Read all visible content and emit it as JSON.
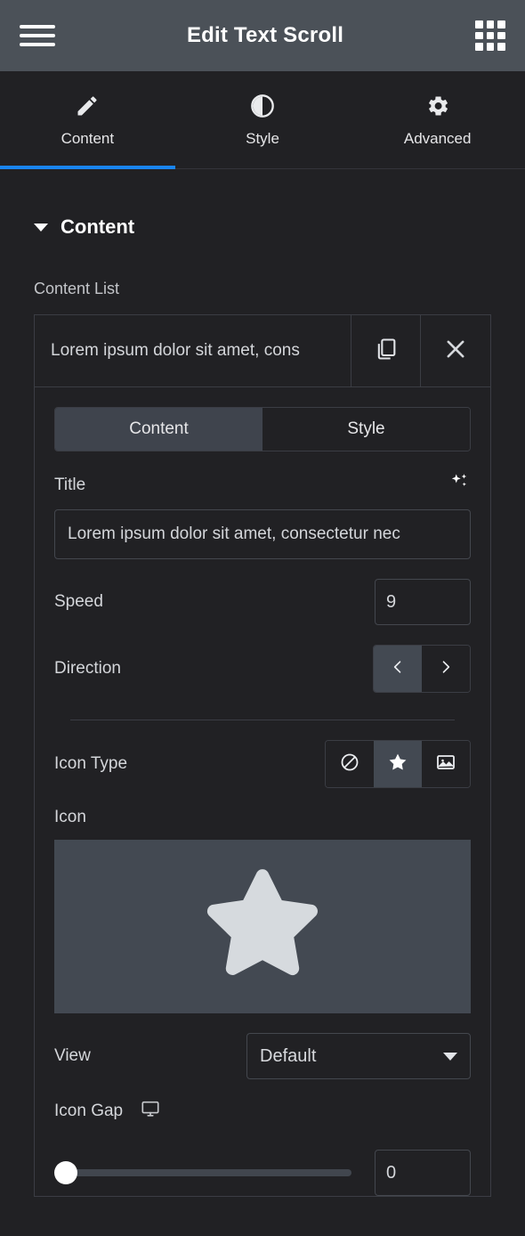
{
  "topbar": {
    "menu_icon": "hamburger-menu-icon",
    "title": "Edit Text Scroll",
    "apps_icon": "apps-grid-icon"
  },
  "main_tabs": [
    {
      "label": "Content",
      "icon": "pencil-icon",
      "active": true
    },
    {
      "label": "Style",
      "icon": "contrast-half-circle-icon",
      "active": false
    },
    {
      "label": "Advanced",
      "icon": "gear-icon",
      "active": false
    }
  ],
  "accent_color": "#1a85f0",
  "section": {
    "title": "Content",
    "collapsed": false
  },
  "content_list": {
    "label": "Content List",
    "items": [
      {
        "title_preview": "Lorem ipsum dolor sit amet, cons",
        "duplicate_icon": "copy-icon",
        "remove_icon": "close-icon"
      }
    ]
  },
  "item_editor": {
    "tabs": [
      {
        "label": "Content",
        "active": true
      },
      {
        "label": "Style",
        "active": false
      }
    ],
    "title": {
      "label": "Title",
      "ai_icon": "ai-sparkles-icon",
      "value": "Lorem ipsum dolor sit amet, consectetur nec"
    },
    "speed": {
      "label": "Speed",
      "value": "9"
    },
    "direction": {
      "label": "Direction",
      "options": [
        {
          "icon": "chevron-left-icon",
          "active": true
        },
        {
          "icon": "chevron-right-icon",
          "active": false
        }
      ]
    },
    "icon_type": {
      "label": "Icon Type",
      "options": [
        {
          "icon": "none-ban-icon",
          "active": false
        },
        {
          "icon": "star-icon",
          "active": true
        },
        {
          "icon": "image-icon",
          "active": false
        }
      ]
    },
    "icon": {
      "label": "Icon",
      "preview_icon": "star-icon"
    },
    "view": {
      "label": "View",
      "value": "Default",
      "caret_icon": "chevron-down-icon"
    },
    "icon_gap": {
      "label": "Icon Gap",
      "device_icon": "desktop-monitor-icon",
      "value": "0",
      "slider_percent": 0
    }
  }
}
